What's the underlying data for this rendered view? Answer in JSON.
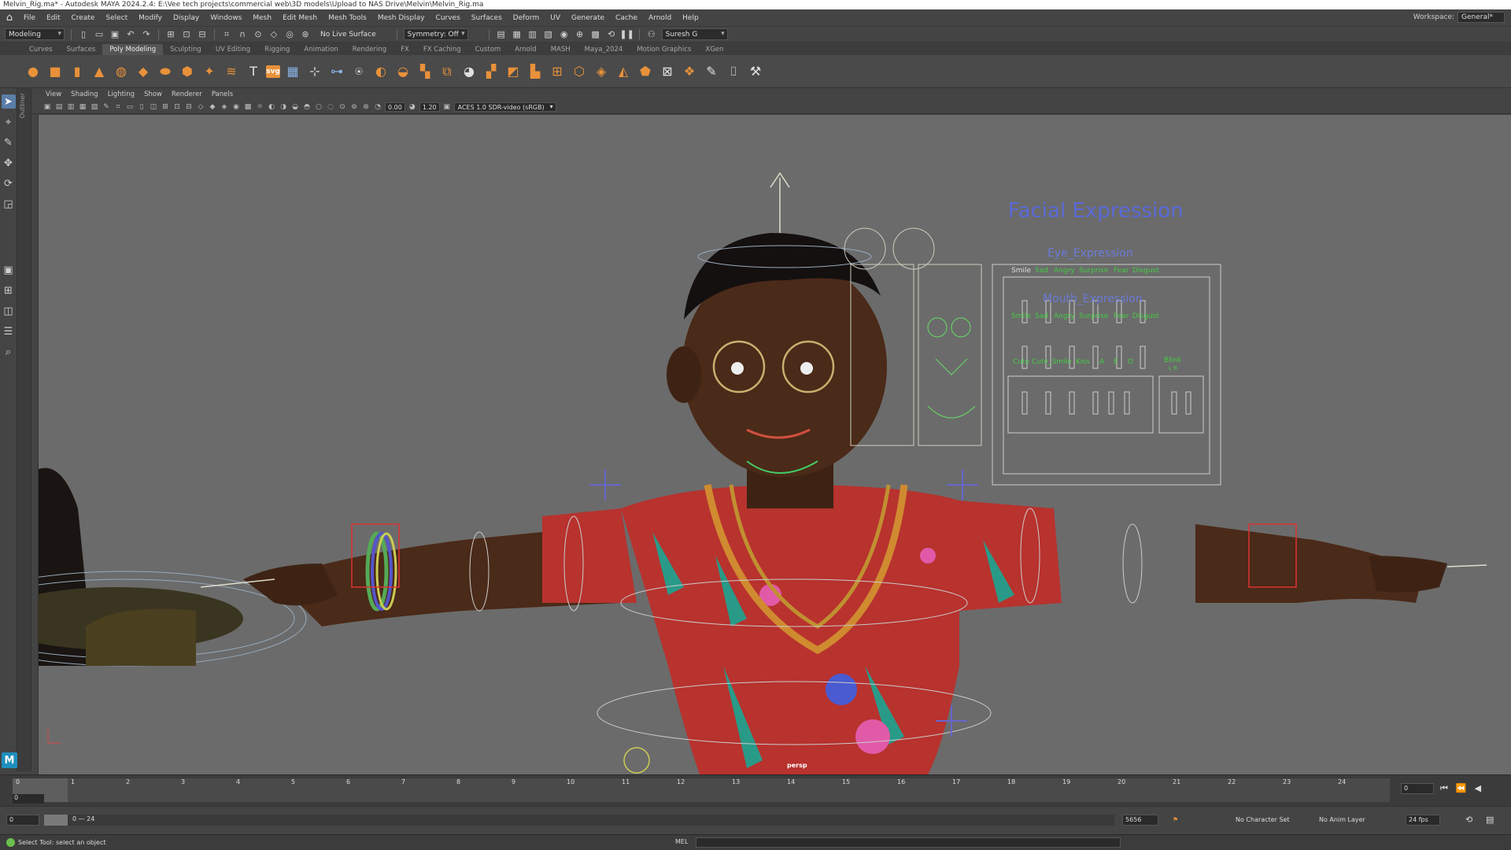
{
  "window": {
    "title": "Melvin_Rig.ma* - Autodesk MAYA 2024.2.4: E:\\Vee tech projects\\commercial web\\3D models\\Upload to NAS Drive\\Melvin\\Melvin_Rig.ma"
  },
  "menubar": {
    "items": [
      "File",
      "Edit",
      "Create",
      "Select",
      "Modify",
      "Display",
      "Windows",
      "Mesh",
      "Edit Mesh",
      "Mesh Tools",
      "Mesh Display",
      "Curves",
      "Surfaces",
      "Deform",
      "UV",
      "Generate",
      "Cache",
      "Arnold",
      "Help"
    ],
    "workspace_label": "Workspace:",
    "workspace_value": "General*"
  },
  "statusline": {
    "menuset": "Modeling",
    "live_surface": "No Live Surface",
    "symmetry": "Symmetry: Off",
    "user": "Suresh G"
  },
  "shelf": {
    "tabs": [
      "Curves",
      "Surfaces",
      "Poly Modeling",
      "Sculpting",
      "UV Editing",
      "Rigging",
      "Animation",
      "Rendering",
      "FX",
      "FX Caching",
      "Custom",
      "Arnold",
      "MASH",
      "Maya_2024",
      "Motion Graphics",
      "XGen"
    ],
    "active_tab": "Poly Modeling",
    "svg_text": "svg"
  },
  "outliner": {
    "label": "Outliner"
  },
  "panel": {
    "menus": [
      "View",
      "Shading",
      "Lighting",
      "Show",
      "Renderer",
      "Panels"
    ],
    "exposure": "0.00",
    "gamma": "1.20",
    "colorspace": "ACES 1.0 SDR-video (sRGB)",
    "camera_label": "persp"
  },
  "facial_ui": {
    "title": "Facial Expression",
    "eye_title": "Eye_Expression",
    "eye_labels": [
      "Smile",
      "Sad",
      "Angry",
      "Surprise",
      "Fear",
      "Disgust"
    ],
    "mouth_title": "Mouth_Expression",
    "mouth_labels": [
      "Smile",
      "Sad",
      "Angry",
      "Surprise",
      "Fear",
      "Disgust"
    ],
    "viseme_labels": [
      "Cute",
      "Cute_Smile",
      "Kiss",
      "A",
      "E",
      "O"
    ],
    "blink_label": "Blink",
    "blink_sides": "L  R"
  },
  "timeline": {
    "frames": [
      "0",
      "1",
      "2",
      "3",
      "4",
      "5",
      "6",
      "7",
      "8",
      "9",
      "10",
      "11",
      "12",
      "13",
      "14",
      "15",
      "16",
      "17",
      "18",
      "19",
      "20",
      "21",
      "22",
      "23",
      "24"
    ],
    "current_frame": "0",
    "current_field": "0"
  },
  "range": {
    "start": "0",
    "range_label": "0 — 24",
    "end_field": "5656",
    "character_set": "No Character Set",
    "anim_layer": "No Anim Layer",
    "fps": "24 fps"
  },
  "helpline": {
    "text": "Select Tool: select an object",
    "mel_label": "MEL"
  }
}
